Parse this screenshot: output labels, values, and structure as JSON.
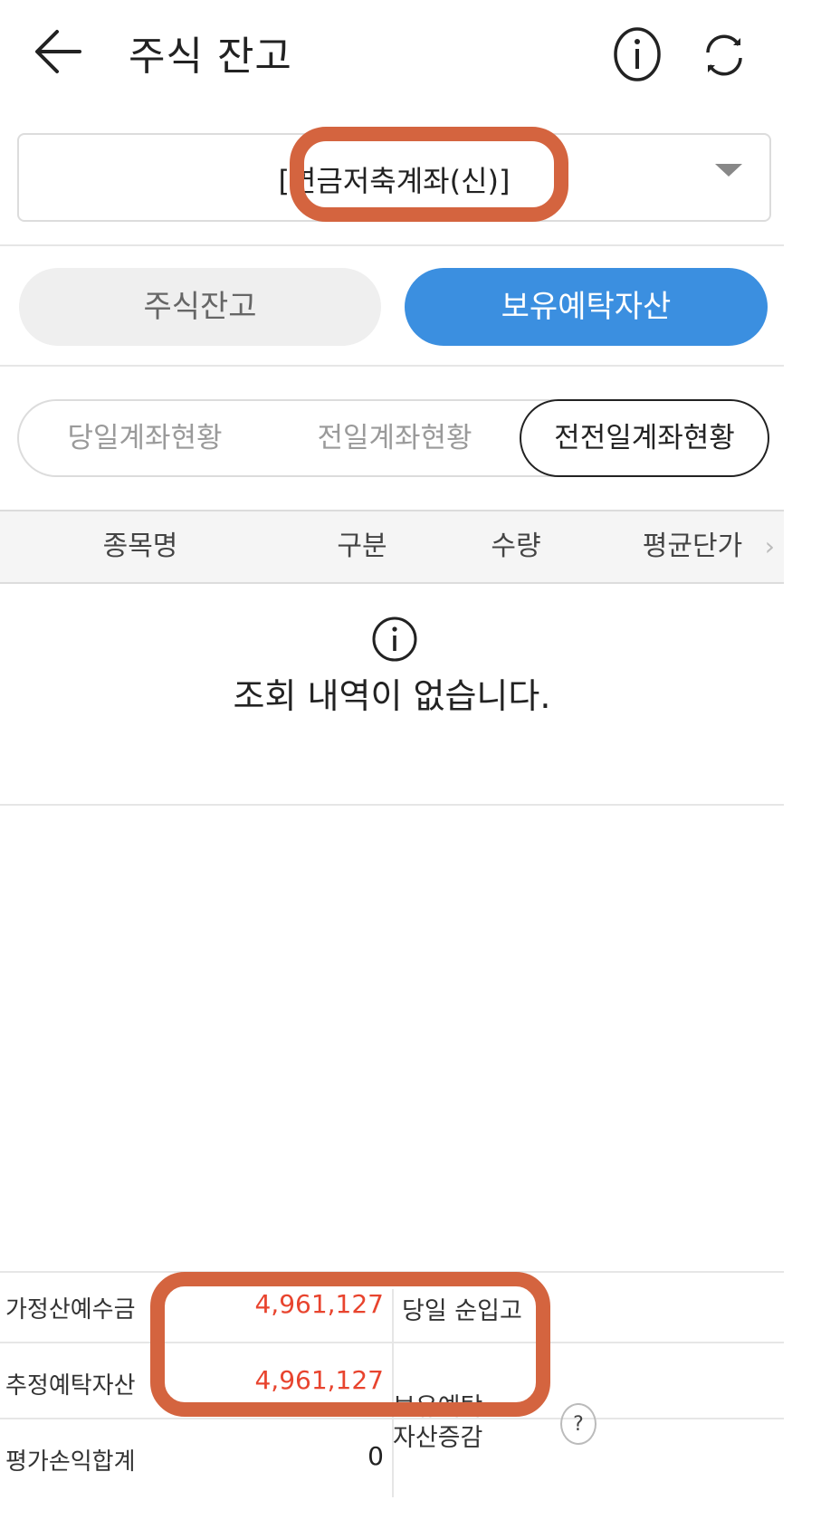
{
  "header": {
    "title": "주식 잔고",
    "back_icon": "arrow-left-icon",
    "info_icon": "info-circle-icon",
    "refresh_icon": "refresh-icon"
  },
  "account_select": {
    "selected": "[연금저축계좌(신)]",
    "caret_icon": "caret-down-icon"
  },
  "main_tabs": [
    {
      "label": "주식잔고",
      "active": false
    },
    {
      "label": "보유예탁자산",
      "active": true
    }
  ],
  "sub_tabs": [
    {
      "label": "당일계좌현황",
      "active": false
    },
    {
      "label": "전일계좌현황",
      "active": false
    },
    {
      "label": "전전일계좌현황",
      "active": true
    }
  ],
  "table": {
    "columns": [
      "종목명",
      "구분",
      "수량",
      "평균단가"
    ],
    "more_icon": "chevron-right-icon"
  },
  "empty_state": {
    "icon": "info-circle-icon",
    "message": "조회 내역이 없습니다."
  },
  "summary": {
    "rows": [
      {
        "label": "가정산예수금",
        "value": "4,961,127"
      },
      {
        "label": "추정예탁자산",
        "value": "4,961,127"
      },
      {
        "label": "평가손익합계",
        "value": "0"
      }
    ],
    "right_labels": {
      "net_deposit": "당일 순입고",
      "asset_change_top": "보유예탁",
      "asset_change_bottom": "자산증감"
    },
    "help_label": "?"
  },
  "colors": {
    "accent": "#3b8fe0",
    "positive": "#e8442e",
    "annotation": "#d4643f"
  }
}
